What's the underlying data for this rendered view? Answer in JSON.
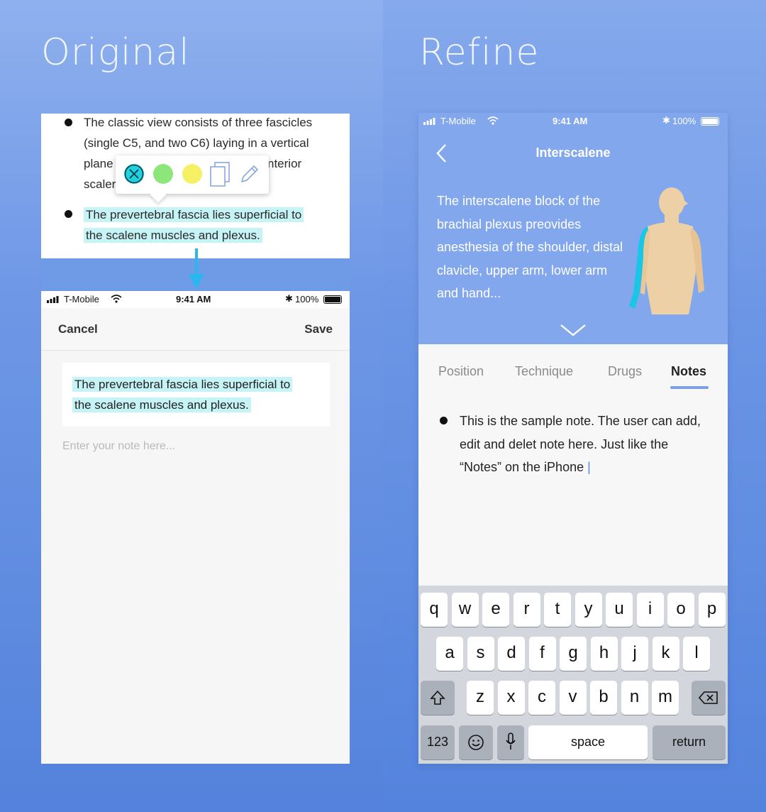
{
  "headings": {
    "left": "Original",
    "right": "Refine"
  },
  "original": {
    "document": {
      "bullet1": "The classic view consists of three fascicles (single C5, and two C6) laying in a vertical plane",
      "bullet1_line1": "The classic view consists of three fascicles",
      "bullet1_line2": "(single C5, and two C6) laying in a vertical",
      "bullet1_line3_left": "plane",
      "bullet1_line3_right": "nterior",
      "bullet1_line4_left": "scaler",
      "bullet2_line1": "The prevertebral fascia lies superficial to",
      "bullet2_line2": "the scalene muscles and plexus."
    },
    "highlight_popover": {
      "swatches": [
        {
          "name": "clear",
          "color": "#1fd2de"
        },
        {
          "name": "green",
          "color": "#8de67a"
        },
        {
          "name": "yellow",
          "color": "#f5f064"
        }
      ],
      "icons": [
        "copy-icon",
        "pencil-icon"
      ]
    },
    "status_bar": {
      "carrier": "T-Mobile",
      "time": "9:41 AM",
      "battery": "100%"
    },
    "nav": {
      "cancel": "Cancel",
      "save": "Save"
    },
    "quote_line1": "The prevertebral fascia lies superficial to",
    "quote_line2": "the scalene muscles and plexus.",
    "note_placeholder": "Enter your note here..."
  },
  "refine": {
    "status_bar": {
      "carrier": "T-Mobile",
      "time": "9:41 AM",
      "battery": "100%"
    },
    "title": "Interscalene",
    "description": "The interscalene block of the brachial plexus preovides anesthesia of the shoulder, distal clavicle, upper arm, lower arm and hand...",
    "tabs": [
      "Position",
      "Technique",
      "Drugs",
      "Notes"
    ],
    "active_tab": "Notes",
    "note": "This is the sample note. The user can add, edit and delet note here. Just like the “Notes” on the iPhone",
    "keyboard": {
      "row1": [
        "q",
        "w",
        "e",
        "r",
        "t",
        "y",
        "u",
        "i",
        "o",
        "p"
      ],
      "row2": [
        "a",
        "s",
        "d",
        "f",
        "g",
        "h",
        "j",
        "k",
        "l"
      ],
      "row3": [
        "z",
        "x",
        "c",
        "v",
        "b",
        "n",
        "m"
      ],
      "numbers": "123",
      "space": "space",
      "return": "return"
    },
    "colors": {
      "accent": "#7da0e4",
      "hero": "#82a7ec",
      "nerve": "#19c6e6",
      "skin": "#eed0a6"
    }
  }
}
